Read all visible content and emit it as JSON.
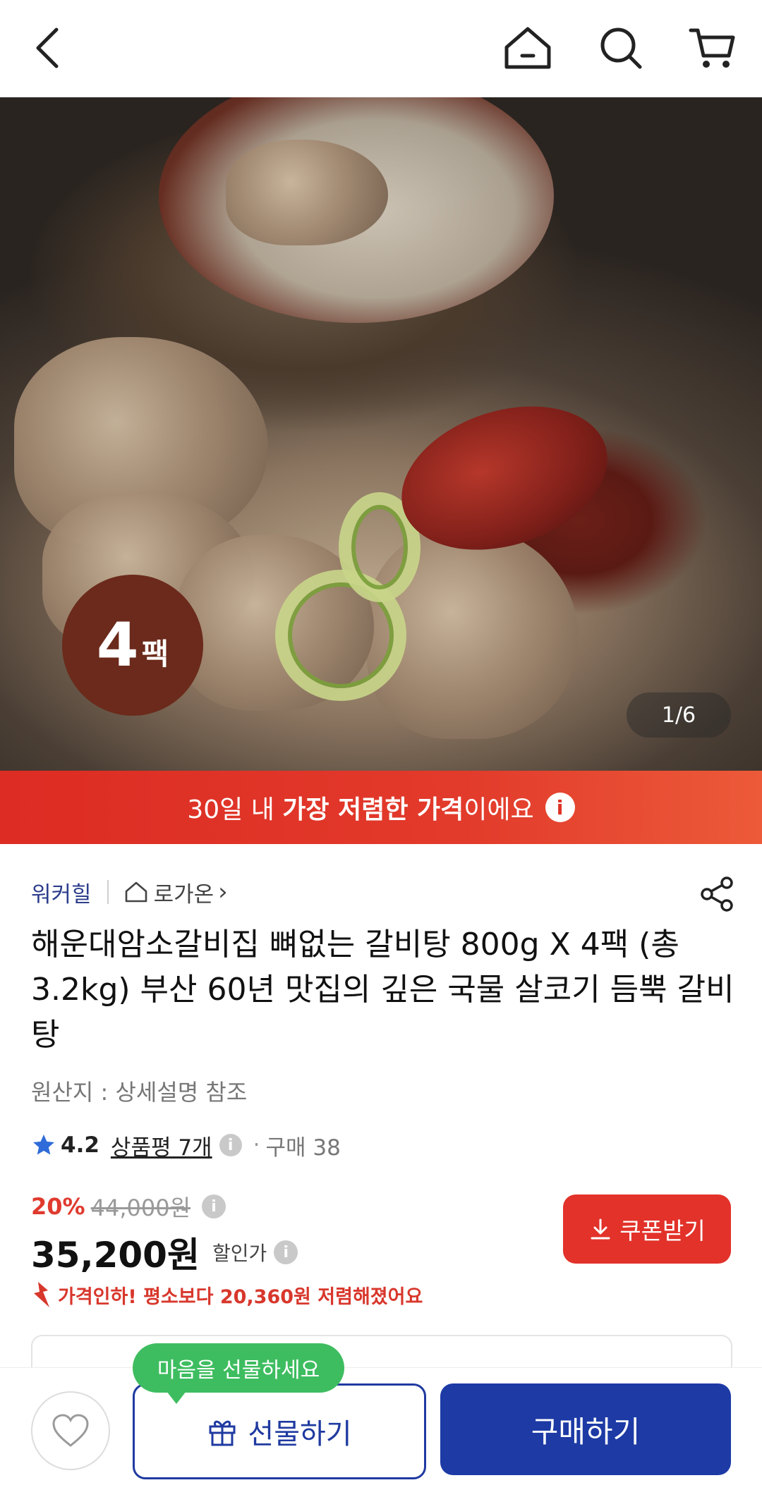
{
  "header": {
    "back_icon": "chevron-left-icon",
    "home_icon": "home-icon",
    "search_icon": "search-icon",
    "cart_icon": "cart-icon"
  },
  "hero": {
    "pack_number": "4",
    "pack_unit": "팩",
    "image_counter": "1/6"
  },
  "banner": {
    "text_prefix": "30일 내 ",
    "text_bold": "가장 저렴한 가격",
    "text_suffix": "이에요",
    "info_symbol": "i",
    "accent_color": "#e0322a"
  },
  "seller": {
    "brand": "워커힐",
    "store": "로가온",
    "store_chevron": "›"
  },
  "product": {
    "title": "해운대암소갈비집 뼈없는 갈비탕 800g X 4팩 (총 3.2kg) 부산 60년 맛집의 깊은 국물 살코기 듬뿍 갈비탕",
    "origin": "원산지 : 상세설명 참조"
  },
  "rating": {
    "score": "4.2",
    "review_text": "상품평 7개",
    "dot": "·",
    "purchase_text": "구매 38",
    "info_symbol": "i"
  },
  "price": {
    "discount_pct": "20%",
    "original_price": "44,000원",
    "final_price": "35,200원",
    "final_label": "할인가",
    "info_symbol": "i",
    "drop_message": "가격인하! 평소보다 20,360원 저렴해졌어요"
  },
  "coupon": {
    "label": "쿠폰받기"
  },
  "bottom_bar": {
    "tooltip": "마음을 선물하세요",
    "gift_label": "선물하기",
    "buy_label": "구매하기",
    "brand_color": "#1d3aa5"
  }
}
